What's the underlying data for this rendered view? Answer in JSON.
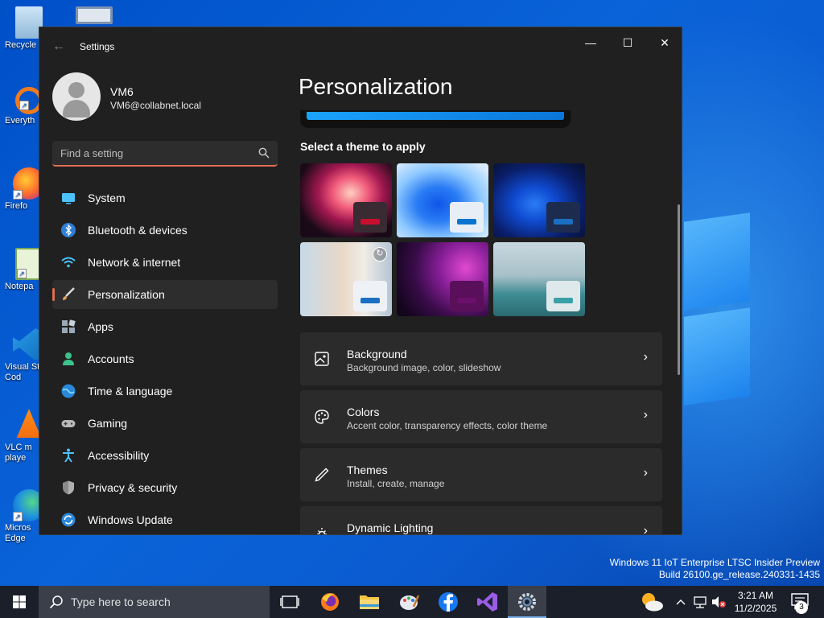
{
  "desktop": {
    "icons": [
      {
        "label": "Recycle",
        "name": "recycle-bin-icon"
      },
      {
        "label": "Everyth",
        "name": "everything-icon"
      },
      {
        "label": "Firefo",
        "name": "firefox-icon"
      },
      {
        "label": "Notepa",
        "name": "notepad-icon"
      },
      {
        "label": "Visual St Cod",
        "name": "vscode-icon"
      },
      {
        "label": "VLC m playe",
        "name": "vlc-icon"
      },
      {
        "label": "Micros Edge",
        "name": "edge-icon"
      }
    ],
    "watermark_line1": "Windows 11 IoT Enterprise LTSC Insider Preview",
    "watermark_line2": "Build 26100.ge_release.240331-1435"
  },
  "window": {
    "title": "Settings",
    "back_glyph": "←",
    "minimize_glyph": "—",
    "maximize_glyph": "☐",
    "close_glyph": "✕"
  },
  "profile": {
    "name": "VM6",
    "email": "VM6@collabnet.local"
  },
  "search": {
    "placeholder": "Find a setting"
  },
  "nav": {
    "items": [
      {
        "label": "System",
        "icon": "system-icon",
        "color": "#4cc2ff"
      },
      {
        "label": "Bluetooth & devices",
        "icon": "bluetooth-icon",
        "color": "#3a8ee6"
      },
      {
        "label": "Network & internet",
        "icon": "wifi-icon",
        "color": "#4cc2ff"
      },
      {
        "label": "Personalization",
        "icon": "brush-icon",
        "color": "#e0a060"
      },
      {
        "label": "Apps",
        "icon": "apps-icon",
        "color": "#9aa8b8"
      },
      {
        "label": "Accounts",
        "icon": "accounts-icon",
        "color": "#3cc28a"
      },
      {
        "label": "Time & language",
        "icon": "globe-icon",
        "color": "#4cc2ff"
      },
      {
        "label": "Gaming",
        "icon": "gamepad-icon",
        "color": "#b8b8b8"
      },
      {
        "label": "Accessibility",
        "icon": "accessibility-icon",
        "color": "#4cc2ff"
      },
      {
        "label": "Privacy & security",
        "icon": "shield-icon",
        "color": "#8a8a8a"
      },
      {
        "label": "Windows Update",
        "icon": "update-icon",
        "color": "#2b88d8"
      }
    ],
    "active_index": 3
  },
  "main": {
    "title": "Personalization",
    "themes_heading": "Select a theme to apply",
    "themes": [
      {
        "name": "glow-theme",
        "accent": "#c8102e"
      },
      {
        "name": "windows-light-theme",
        "accent": "#0a74d0"
      },
      {
        "name": "windows-dark-theme",
        "accent": "#1b6fc2"
      },
      {
        "name": "spotlight-theme",
        "accent": "#1b6fc2"
      },
      {
        "name": "sunrise-theme",
        "accent": "#6a0f6a"
      },
      {
        "name": "flow-theme",
        "accent": "#3aa0a8"
      }
    ],
    "cards": [
      {
        "title": "Background",
        "subtitle": "Background image, color, slideshow",
        "icon": "image-icon"
      },
      {
        "title": "Colors",
        "subtitle": "Accent color, transparency effects, color theme",
        "icon": "palette-icon"
      },
      {
        "title": "Themes",
        "subtitle": "Install, create, manage",
        "icon": "pen-icon"
      },
      {
        "title": "Dynamic Lighting",
        "subtitle": "",
        "icon": "lighting-icon"
      }
    ],
    "chevron": "›"
  },
  "taskbar": {
    "search_text": "Type here to search",
    "apps": [
      "task-view-icon",
      "firefox-icon",
      "file-explorer-icon",
      "paint-icon",
      "facebook-icon",
      "visual-studio-icon",
      "settings-icon"
    ],
    "time": "3:21 AM",
    "date": "11/2/2025",
    "notification_count": "3"
  }
}
